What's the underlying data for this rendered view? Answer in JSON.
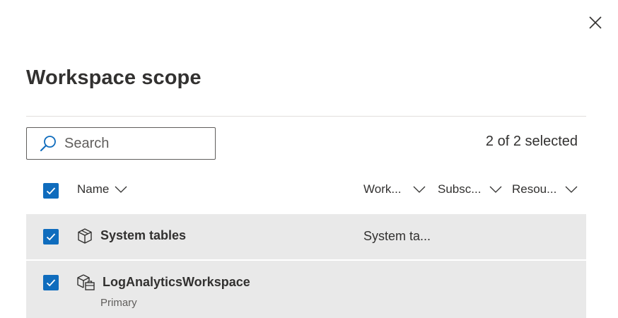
{
  "panel": {
    "title": "Workspace scope",
    "close_label": "Close"
  },
  "search": {
    "placeholder": "Search",
    "value": ""
  },
  "selection": {
    "count_text": "2 of 2 selected",
    "all_selected": true
  },
  "table": {
    "columns": [
      {
        "label": "Name"
      },
      {
        "label": "Work..."
      },
      {
        "label": "Subsc..."
      },
      {
        "label": "Resou..."
      }
    ],
    "rows": [
      {
        "name": "System tables",
        "subtitle": "",
        "workspace": "System ta...",
        "icon": "cube-icon",
        "selected": true
      },
      {
        "name": "LogAnalyticsWorkspace",
        "subtitle": "Primary",
        "workspace": "",
        "icon": "workspace-icon",
        "selected": true
      }
    ]
  },
  "colors": {
    "accent": "#0f6cbd",
    "row_background": "#e9e9e9",
    "divider": "#e1dfdd",
    "text": "#323130"
  }
}
